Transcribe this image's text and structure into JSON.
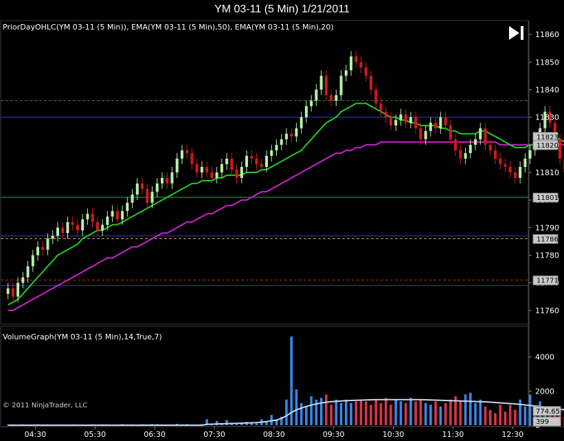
{
  "title": "YM 03-11 (5 Min)  1/21/2011",
  "price_panel": {
    "indicator_label": "PriorDayOHLC(YM 03-11 (5 Min)), EMA(YM 03-11 (5 Min),50), EMA(YM 03-11 (5 Min),20)",
    "y_ticks": [
      "11860",
      "11850",
      "11840",
      "11830",
      "11820",
      "11810",
      "11800",
      "11790",
      "11780",
      "11770",
      "11760"
    ],
    "price_flags": [
      "11823",
      "11820",
      "11801",
      "11786",
      "11771"
    ],
    "play_icon": "skip-to-end-icon"
  },
  "volume_panel": {
    "indicator_label": "VolumeGraph(YM 03-11 (5 Min),14,True,7)",
    "y_ticks": [
      "4000",
      "2000",
      "0"
    ],
    "value_flags": [
      "774.65",
      "399"
    ],
    "copyright": "© 2011 NinjaTrader, LLC"
  },
  "x_ticks": [
    "04:30",
    "05:30",
    "06:30",
    "07:30",
    "08:30",
    "09:30",
    "10:30",
    "11:30",
    "12:30"
  ],
  "colors": {
    "up": "#b6f0a8",
    "down": "#d01a1a",
    "ema20": "#22cc22",
    "ema50": "#cc22cc",
    "volume_up": "#3a86e8",
    "volume_down": "#d8354a",
    "volume_avg": "#c8d8ee"
  },
  "chart_data": {
    "type": "candlestick",
    "title": "YM 03-11 (5 Min)  1/21/2011",
    "interval_minutes": 5,
    "x_range": [
      "04:00",
      "12:45"
    ],
    "ylim": [
      11755,
      11865
    ],
    "levels": [
      {
        "value": 11836,
        "color": "#2a8c2a",
        "style": "dashed"
      },
      {
        "value": 11830,
        "color": "#3040c8",
        "style": "solid"
      },
      {
        "value": 11801,
        "color": "#22aa55",
        "style": "solid"
      },
      {
        "value": 11787,
        "color": "#3040c8",
        "style": "solid"
      },
      {
        "value": 11786,
        "color": "#ff9a3c",
        "style": "dashed"
      },
      {
        "value": 11771,
        "color": "#d02020",
        "style": "dashed"
      },
      {
        "value": 11769,
        "color": "#3040c8",
        "style": "solid"
      }
    ],
    "close": [
      11768,
      11765,
      11770,
      11772,
      11776,
      11780,
      11783,
      11782,
      11786,
      11787,
      11790,
      11788,
      11792,
      11791,
      11789,
      11793,
      11795,
      11792,
      11789,
      11791,
      11794,
      11796,
      11793,
      11796,
      11799,
      11802,
      11806,
      11804,
      11799,
      11803,
      11806,
      11808,
      11806,
      11810,
      11815,
      11818,
      11817,
      11813,
      11810,
      11812,
      11810,
      11808,
      11810,
      11813,
      11815,
      11811,
      11808,
      11812,
      11816,
      11815,
      11813,
      11812,
      11816,
      11818,
      11820,
      11822,
      11824,
      11823,
      11826,
      11830,
      11834,
      11836,
      11840,
      11845,
      11838,
      11836,
      11838,
      11845,
      11847,
      11852,
      11850,
      11848,
      11845,
      11840,
      11835,
      11832,
      11830,
      11827,
      11829,
      11831,
      11828,
      11830,
      11826,
      11822,
      11825,
      11828,
      11826,
      11830,
      11827,
      11822,
      11818,
      11815,
      11817,
      11820,
      11822,
      11826,
      11820,
      11818,
      11815,
      11813,
      11812,
      11810,
      11808,
      11812,
      11815,
      11818,
      11821,
      11826,
      11832,
      11828,
      11822,
      11815,
      11810,
      11808,
      11806,
      11810,
      11803,
      11801,
      11810,
      11818,
      11826,
      11825,
      11830,
      11823
    ],
    "ema20": [
      11762,
      11763,
      11764,
      11766,
      11768,
      11770,
      11772,
      11774,
      11776,
      11778,
      11780,
      11781,
      11782,
      11783,
      11784,
      11786,
      11787,
      11788,
      11789,
      11789,
      11790,
      11791,
      11791,
      11792,
      11793,
      11794,
      11795,
      11796,
      11797,
      11798,
      11799,
      11800,
      11801,
      11802,
      11803,
      11804,
      11805,
      11806,
      11806,
      11807,
      11807,
      11807,
      11808,
      11808,
      11809,
      11809,
      11809,
      11809,
      11810,
      11810,
      11810,
      11811,
      11811,
      11812,
      11813,
      11814,
      11815,
      11816,
      11817,
      11818,
      11820,
      11822,
      11824,
      11826,
      11828,
      11829,
      11830,
      11832,
      11833,
      11834,
      11835,
      11835,
      11835,
      11834,
      11833,
      11832,
      11831,
      11830,
      11830,
      11829,
      11829,
      11828,
      11828,
      11827,
      11827,
      11827,
      11827,
      11826,
      11826,
      11825,
      11825,
      11824,
      11824,
      11824,
      11824,
      11825,
      11825,
      11824,
      11823,
      11822,
      11821,
      11820,
      11819,
      11819,
      11819,
      11820,
      11820,
      11821,
      11822,
      11823,
      11823,
      11822,
      11821,
      11820,
      11819,
      11818,
      11817,
      11816,
      11817,
      11817,
      11818,
      11818,
      11819,
      11820
    ],
    "ema50": [
      11760,
      11760,
      11761,
      11762,
      11763,
      11764,
      11765,
      11766,
      11767,
      11768,
      11769,
      11770,
      11771,
      11772,
      11773,
      11774,
      11775,
      11776,
      11777,
      11778,
      11779,
      11779,
      11780,
      11781,
      11782,
      11783,
      11783,
      11784,
      11785,
      11786,
      11787,
      11788,
      11788,
      11789,
      11790,
      11791,
      11792,
      11792,
      11793,
      11794,
      11795,
      11795,
      11796,
      11797,
      11798,
      11798,
      11799,
      11800,
      11800,
      11801,
      11802,
      11803,
      11803,
      11804,
      11805,
      11806,
      11807,
      11808,
      11809,
      11810,
      11811,
      11812,
      11813,
      11814,
      11815,
      11816,
      11817,
      11817,
      11818,
      11818,
      11819,
      11819,
      11820,
      11820,
      11820,
      11821,
      11821,
      11821,
      11821,
      11821,
      11821,
      11821,
      11821,
      11821,
      11821,
      11821,
      11821,
      11821,
      11821,
      11821,
      11821,
      11821,
      11821,
      11821,
      11821,
      11821,
      11821,
      11821,
      11821,
      11820,
      11820,
      11820,
      11820,
      11820,
      11820,
      11820,
      11820,
      11820,
      11820,
      11820,
      11820,
      11820,
      11820,
      11819,
      11819,
      11819,
      11819,
      11818,
      11818,
      11818,
      11818,
      11818,
      11819,
      11820
    ],
    "volume": [
      40,
      45,
      35,
      50,
      30,
      40,
      55,
      45,
      50,
      35,
      40,
      45,
      30,
      50,
      40,
      45,
      35,
      55,
      40,
      50,
      45,
      40,
      35,
      60,
      45,
      50,
      40,
      55,
      45,
      70,
      60,
      50,
      40,
      45,
      80,
      50,
      60,
      40,
      45,
      60,
      350,
      90,
      250,
      70,
      300,
      150,
      120,
      80,
      200,
      150,
      100,
      350,
      250,
      600,
      300,
      500,
      1500,
      5200,
      2100,
      1300,
      1100,
      1700,
      1500,
      1600,
      1800,
      1200,
      1500,
      1300,
      1500,
      1300,
      1400,
      1500,
      1400,
      1200,
      1500,
      1300,
      1600,
      1200,
      1500,
      1400,
      1300,
      1600,
      1400,
      1500,
      1300,
      1200,
      1400,
      1100,
      1300,
      1500,
      1700,
      1400,
      1800,
      1900,
      1300,
      1500,
      1100,
      900,
      700,
      1200,
      800,
      1200,
      900,
      1500,
      1100,
      1800,
      1000,
      1400,
      800,
      700,
      600,
      1000,
      500,
      800,
      650,
      700,
      900,
      1000,
      600,
      500
    ],
    "volume_avg": [
      0,
      0,
      0,
      0,
      0,
      0,
      0,
      0,
      0,
      0,
      0,
      0,
      0,
      0,
      0,
      0,
      0,
      0,
      0,
      0,
      0,
      0,
      0,
      0,
      0,
      0,
      0,
      0,
      0,
      0,
      0,
      0,
      0,
      0,
      0,
      0,
      0,
      0,
      0,
      0,
      50,
      60,
      70,
      80,
      90,
      100,
      110,
      120,
      130,
      140,
      150,
      180,
      210,
      260,
      300,
      400,
      550,
      750,
      900,
      1000,
      1100,
      1180,
      1250,
      1300,
      1350,
      1380,
      1400,
      1420,
      1440,
      1450,
      1460,
      1470,
      1480,
      1490,
      1500,
      1500,
      1500,
      1500,
      1500,
      1500,
      1500,
      1500,
      1500,
      1500,
      1490,
      1480,
      1470,
      1460,
      1450,
      1440,
      1430,
      1420,
      1410,
      1400,
      1390,
      1380,
      1370,
      1350,
      1330,
      1310,
      1290,
      1270,
      1250,
      1220,
      1190,
      1160,
      1130,
      1100,
      1060,
      1020,
      980,
      940,
      900,
      870,
      840,
      820,
      800,
      790,
      780,
      775,
      775,
      775
    ]
  }
}
